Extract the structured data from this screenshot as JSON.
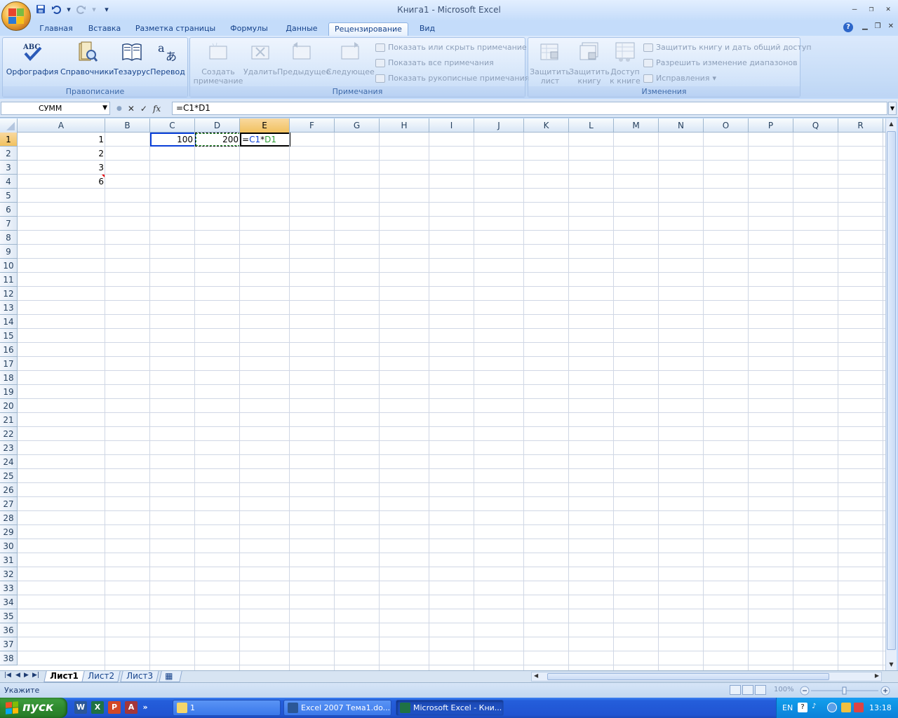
{
  "window": {
    "title": "Книга1 - Microsoft Excel",
    "minimize": "–",
    "restore": "❐",
    "close": "✕"
  },
  "qat": {
    "save_icon": "save-icon",
    "undo_icon": "undo-icon",
    "redo_icon": "redo-icon",
    "customize": "▾"
  },
  "tabs": [
    "Главная",
    "Вставка",
    "Разметка страницы",
    "Формулы",
    "Данные",
    "Рецензирование",
    "Вид"
  ],
  "active_tab": "Рецензирование",
  "help": "?",
  "ribbon": {
    "proofing": {
      "label": "Правописание",
      "spelling": "Орфография",
      "research": "Справочники",
      "thesaurus": "Тезаурус",
      "translate": "Перевод"
    },
    "comments": {
      "label": "Примечания",
      "new_line1": "Создать",
      "new_line2": "примечание",
      "delete": "Удалить",
      "previous": "Предыдущее",
      "next": "Следующее",
      "show_hide": "Показать или скрыть примечание",
      "show_all": "Показать все примечания",
      "show_ink": "Показать рукописные примечания"
    },
    "changes": {
      "label": "Изменения",
      "protect_sheet_line1": "Защитить",
      "protect_sheet_line2": "лист",
      "protect_book_line1": "Защитить",
      "protect_book_line2": "книгу",
      "share_line1": "Доступ",
      "share_line2": "к книге",
      "protect_share": "Защитить книгу и дать общий доступ",
      "allow_ranges": "Разрешить изменение диапазонов",
      "track": "Исправления"
    }
  },
  "formula_bar": {
    "name_box": "СУММ",
    "cancel": "✕",
    "enter": "✓",
    "fx": "fx",
    "content": "=C1*D1"
  },
  "columns": [
    "A",
    "B",
    "C",
    "D",
    "E",
    "F",
    "G",
    "H",
    "I",
    "J",
    "K",
    "L",
    "M",
    "N",
    "O",
    "P",
    "Q",
    "R"
  ],
  "selected_column": "E",
  "rows": [
    "1",
    "2",
    "3",
    "4",
    "5",
    "6",
    "7",
    "8",
    "9",
    "10",
    "11",
    "12",
    "13",
    "14",
    "15",
    "16",
    "17",
    "18",
    "19",
    "20",
    "21",
    "22",
    "23",
    "24",
    "25",
    "26",
    "27",
    "28",
    "29",
    "30",
    "31",
    "32",
    "33",
    "34",
    "35",
    "36",
    "37",
    "38"
  ],
  "selected_row": "1",
  "cells": {
    "A1": "1",
    "A2": "2",
    "A3": "3",
    "A4": "6",
    "C1": "100",
    "D1": "200",
    "E1_prefix": "=",
    "E1_ref1": "C1",
    "E1_op": "*",
    "E1_ref2": "D1"
  },
  "comment_cell": "A4",
  "sheets": [
    "Лист1",
    "Лист2",
    "Лист3"
  ],
  "active_sheet": "Лист1",
  "status": {
    "mode": "Укажите",
    "zoom": "100%"
  },
  "taskbar": {
    "start": "пуск",
    "tasks": [
      {
        "label": "1",
        "icon": "folder-icon"
      },
      {
        "label": "Excel 2007 Тема1.do...",
        "icon": "word-icon"
      },
      {
        "label": "Microsoft Excel - Кни...",
        "icon": "excel-icon"
      }
    ],
    "lang": "EN",
    "clock": "13:18"
  },
  "colors": {
    "ref_c1": "#0a3fd8",
    "ref_d1": "#2f9d36",
    "header_selected": "#f1c15f"
  }
}
